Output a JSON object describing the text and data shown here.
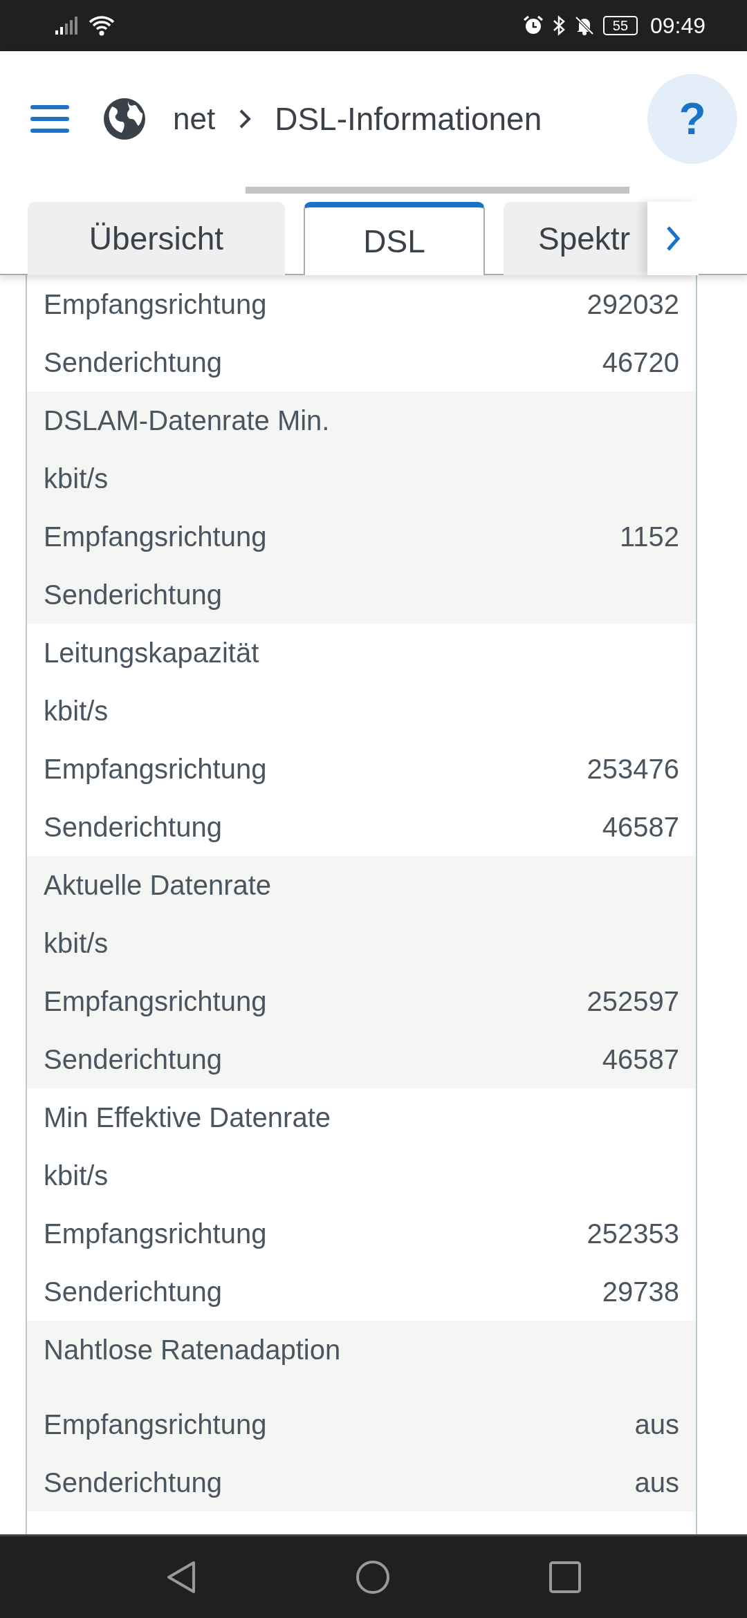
{
  "status_bar": {
    "time": "09:49",
    "battery": "55"
  },
  "breadcrumb": {
    "parent": "net",
    "current": "DSL-Informationen"
  },
  "help": {
    "label": "?"
  },
  "tabs": [
    {
      "label": "Übersicht",
      "selected": false
    },
    {
      "label": "DSL",
      "selected": true
    },
    {
      "label": "Spektr",
      "selected": false
    }
  ],
  "groups": [
    {
      "rows": [
        {
          "label": "Empfangsrichtung",
          "value": "292032"
        },
        {
          "label": "Senderichtung",
          "value": "46720"
        }
      ]
    },
    {
      "title": "DSLAM-Datenrate Min.",
      "unit": "kbit/s",
      "rows": [
        {
          "label": "Empfangsrichtung",
          "value": "1152"
        },
        {
          "label": "Senderichtung"
        }
      ]
    },
    {
      "title": "Leitungskapazität",
      "unit": "kbit/s",
      "rows": [
        {
          "label": "Empfangsrichtung",
          "value": "253476"
        },
        {
          "label": "Senderichtung",
          "value": "46587"
        }
      ]
    },
    {
      "title": "Aktuelle Datenrate",
      "unit": "kbit/s",
      "rows": [
        {
          "label": "Empfangsrichtung",
          "value": "252597"
        },
        {
          "label": "Senderichtung",
          "value": "46587"
        }
      ]
    },
    {
      "title": "Min Effektive Datenrate",
      "unit": "kbit/s",
      "rows": [
        {
          "label": "Empfangsrichtung",
          "value": "252353"
        },
        {
          "label": "Senderichtung",
          "value": "29738"
        }
      ]
    },
    {
      "title": "Nahtlose Ratenadaption",
      "rows": [
        {
          "label": "Empfangsrichtung",
          "value": "aus"
        },
        {
          "label": "Senderichtung",
          "value": "aus"
        }
      ]
    }
  ]
}
